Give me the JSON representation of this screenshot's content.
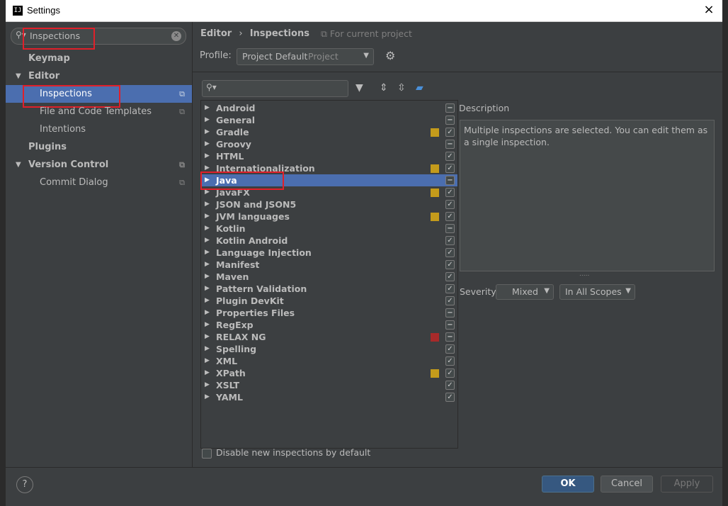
{
  "window": {
    "title": "Settings",
    "app_icon": "intellij-icon",
    "close_label": "×"
  },
  "left": {
    "search": {
      "value": "Inspections"
    },
    "tree": [
      {
        "label": "Keymap",
        "bold": true
      },
      {
        "label": "Editor",
        "bold": true,
        "expanded": true
      },
      {
        "label": "Inspections",
        "selected": true
      },
      {
        "label": "File and Code Templates"
      },
      {
        "label": "Intentions"
      },
      {
        "label": "Plugins",
        "bold": true
      },
      {
        "label": "Version Control",
        "bold": true,
        "expanded": true
      },
      {
        "label": "Commit Dialog"
      }
    ]
  },
  "header": {
    "crumb_parent": "Editor",
    "crumb_separator": "›",
    "crumb_current": "Inspections",
    "for_project": "For current project",
    "profile_label": "Profile:",
    "profile_value": "Project Default",
    "profile_scope": "Project"
  },
  "inspections": [
    {
      "label": "Android",
      "check": "partial"
    },
    {
      "label": "General",
      "check": "partial"
    },
    {
      "label": "Gradle",
      "check": "checked",
      "severity": "#c49b1b"
    },
    {
      "label": "Groovy",
      "check": "partial"
    },
    {
      "label": "HTML",
      "check": "checked"
    },
    {
      "label": "Internationalization",
      "check": "checked",
      "severity": "#c49b1b"
    },
    {
      "label": "Java",
      "check": "partial",
      "selected": true
    },
    {
      "label": "JavaFX",
      "check": "checked",
      "severity": "#c49b1b"
    },
    {
      "label": "JSON and JSON5",
      "check": "checked"
    },
    {
      "label": "JVM languages",
      "check": "checked",
      "severity": "#c49b1b"
    },
    {
      "label": "Kotlin",
      "check": "partial"
    },
    {
      "label": "Kotlin Android",
      "check": "checked"
    },
    {
      "label": "Language Injection",
      "check": "checked"
    },
    {
      "label": "Manifest",
      "check": "checked"
    },
    {
      "label": "Maven",
      "check": "checked"
    },
    {
      "label": "Pattern Validation",
      "check": "checked"
    },
    {
      "label": "Plugin DevKit",
      "check": "checked"
    },
    {
      "label": "Properties Files",
      "check": "partial"
    },
    {
      "label": "RegExp",
      "check": "partial"
    },
    {
      "label": "RELAX NG",
      "check": "partial",
      "severity": "#a72a2a"
    },
    {
      "label": "Spelling",
      "check": "checked"
    },
    {
      "label": "XML",
      "check": "checked"
    },
    {
      "label": "XPath",
      "check": "checked",
      "severity": "#c49b1b"
    },
    {
      "label": "XSLT",
      "check": "checked"
    },
    {
      "label": "YAML",
      "check": "checked"
    }
  ],
  "description": {
    "label": "Description",
    "text": "Multiple inspections are selected. You can edit them as a single inspection.",
    "grip": "....."
  },
  "severity": {
    "label": "Severity:",
    "value": "Mixed",
    "scope": "In All Scopes"
  },
  "disable_new": {
    "label": "Disable new inspections by default",
    "checked": false
  },
  "buttons": {
    "help": "?",
    "ok": "OK",
    "cancel": "Cancel",
    "apply": "Apply"
  },
  "colors": {
    "selection": "#4b6eaf",
    "highlight": "#e0202a",
    "warning": "#c49b1b",
    "error": "#a72a2a"
  }
}
